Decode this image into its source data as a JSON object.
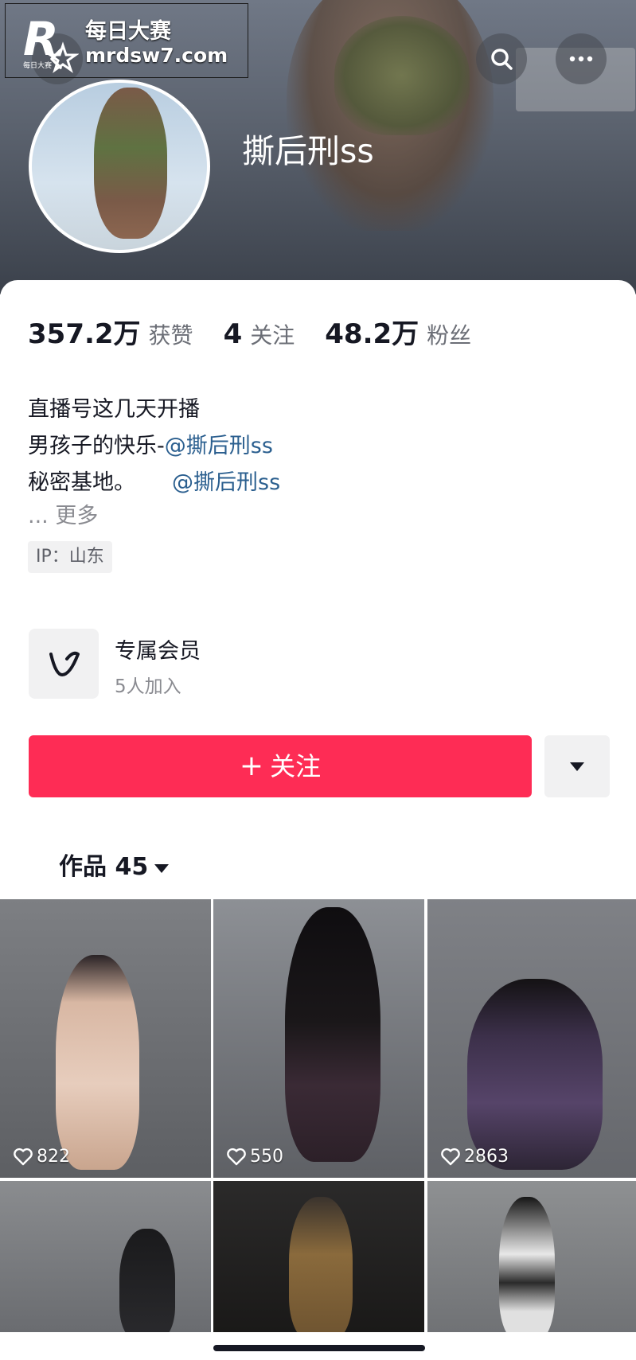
{
  "watermark": {
    "logo_letter": "R",
    "logo_sub": "每日大赛",
    "line1": "每日大赛",
    "line2": "mrdsw7.com"
  },
  "header": {
    "username": "撕后刑ss",
    "icons": [
      "back-icon",
      "search-icon",
      "more-icon"
    ]
  },
  "stats": [
    {
      "value": "357.2万",
      "label": "获赞"
    },
    {
      "value": "4",
      "label": "关注"
    },
    {
      "value": "48.2万",
      "label": "粉丝"
    }
  ],
  "bio": {
    "line1": "直播号这几天开播",
    "line2_text": "男孩子的快乐-",
    "line2_mention": "@撕后刑ss",
    "line3_text": "秘密基地。",
    "line3_mention": "@撕后刑ss",
    "more": "... 更多",
    "ip": "IP：山东"
  },
  "membership": {
    "title": "专属会员",
    "count": "5人加入"
  },
  "actions": {
    "follow_plus": "+",
    "follow_label": "关注"
  },
  "works": {
    "label": "作品 45"
  },
  "grid": [
    {
      "likes": "822"
    },
    {
      "likes": "550"
    },
    {
      "likes": "2863"
    },
    {
      "likes": ""
    },
    {
      "likes": ""
    },
    {
      "likes": ""
    }
  ],
  "colors": {
    "accent": "#fe2c55",
    "mention": "#2b5f8f",
    "text": "#161823",
    "secondary": "#8a8b91"
  }
}
